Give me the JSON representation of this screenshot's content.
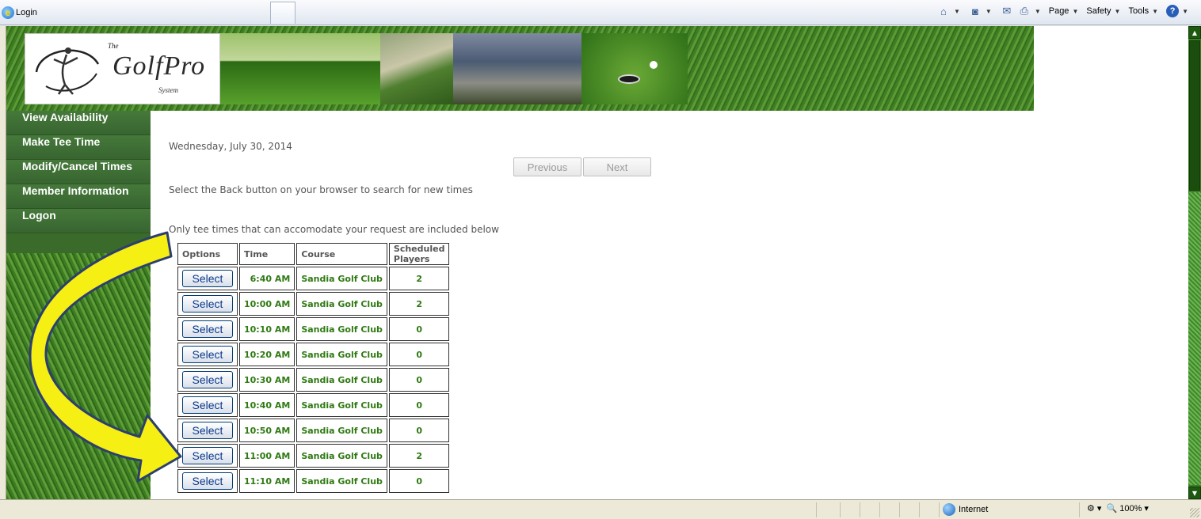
{
  "browser": {
    "tab_title": "Login",
    "toolbar": {
      "page_label": "Page",
      "safety_label": "Safety",
      "tools_label": "Tools"
    },
    "status": {
      "zone": "Internet",
      "zoom": "100%"
    }
  },
  "logo": {
    "the": "The",
    "name": "GolfPro",
    "sub": "System"
  },
  "nav": {
    "items": [
      {
        "label": "View Availability"
      },
      {
        "label": "Make Tee Time"
      },
      {
        "label": "Modify/Cancel Times"
      },
      {
        "label": "Member Information"
      },
      {
        "label": "Logon"
      }
    ]
  },
  "content": {
    "date": "Wednesday, July 30, 2014",
    "previous_label": "Previous",
    "next_label": "Next",
    "back_note": "Select the Back button on your browser to search for new times",
    "only_note": "Only tee times that can accomodate your request are included below"
  },
  "table": {
    "headers": [
      "Options",
      "Time",
      "Course",
      "Scheduled Players"
    ],
    "rows": [
      {
        "action": "Select",
        "time": "6:40 AM",
        "course": "Sandia Golf Club",
        "players": "2"
      },
      {
        "action": "Select",
        "time": "10:00 AM",
        "course": "Sandia Golf Club",
        "players": "2"
      },
      {
        "action": "Select",
        "time": "10:10 AM",
        "course": "Sandia Golf Club",
        "players": "0"
      },
      {
        "action": "Select",
        "time": "10:20 AM",
        "course": "Sandia Golf Club",
        "players": "0"
      },
      {
        "action": "Select",
        "time": "10:30 AM",
        "course": "Sandia Golf Club",
        "players": "0"
      },
      {
        "action": "Select",
        "time": "10:40 AM",
        "course": "Sandia Golf Club",
        "players": "0"
      },
      {
        "action": "Select",
        "time": "10:50 AM",
        "course": "Sandia Golf Club",
        "players": "0"
      },
      {
        "action": "Select",
        "time": "11:00 AM",
        "course": "Sandia Golf Club",
        "players": "2"
      },
      {
        "action": "Select",
        "time": "11:10 AM",
        "course": "Sandia Golf Club",
        "players": "0"
      }
    ]
  },
  "colors": {
    "nav_text": "#ffffff",
    "table_text": "#2f7a12",
    "arrow_fill": "#f5ef14",
    "arrow_stroke": "#2c3f6e"
  }
}
